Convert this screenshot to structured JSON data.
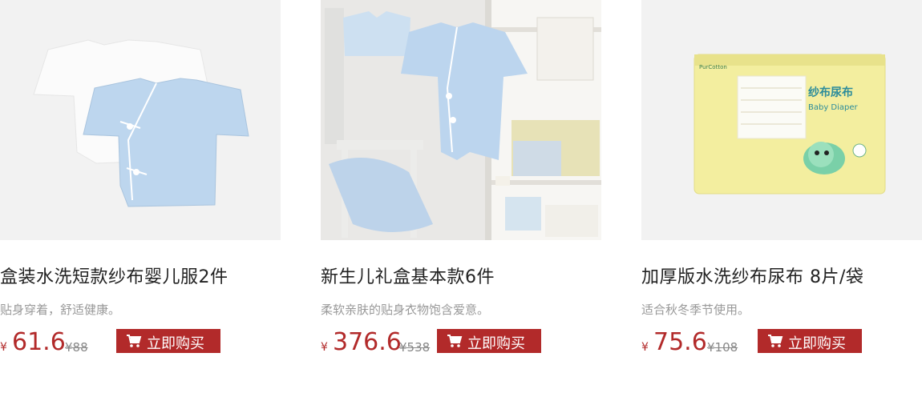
{
  "products": [
    {
      "title": "盒装水洗短款纱布婴儿服2件",
      "desc": "贴身穿着，舒适健康。",
      "currency": "¥",
      "price": "61.6",
      "orig_price": "¥88",
      "buy_label": "立即购买",
      "image_icon": "baby-clothes-image"
    },
    {
      "title": "新生儿礼盒基本款6件",
      "desc": "柔软亲肤的贴身衣物饱含爱意。",
      "currency": "¥",
      "price": "376.6",
      "orig_price": "¥538",
      "buy_label": "立即购买",
      "image_icon": "gift-set-image"
    },
    {
      "title": "加厚版水洗纱布尿布 8片/袋",
      "desc": "适合秋冬季节使用。",
      "currency": "¥",
      "price": "75.6",
      "orig_price": "¥108",
      "buy_label": "立即购买",
      "image_icon": "diaper-pack-image",
      "package_brand": "PurCotton",
      "package_title": "纱布尿布",
      "package_subtitle": "Baby Diaper"
    }
  ],
  "colors": {
    "accent": "#b22a2a",
    "image_bg": "#f3f3f3"
  }
}
